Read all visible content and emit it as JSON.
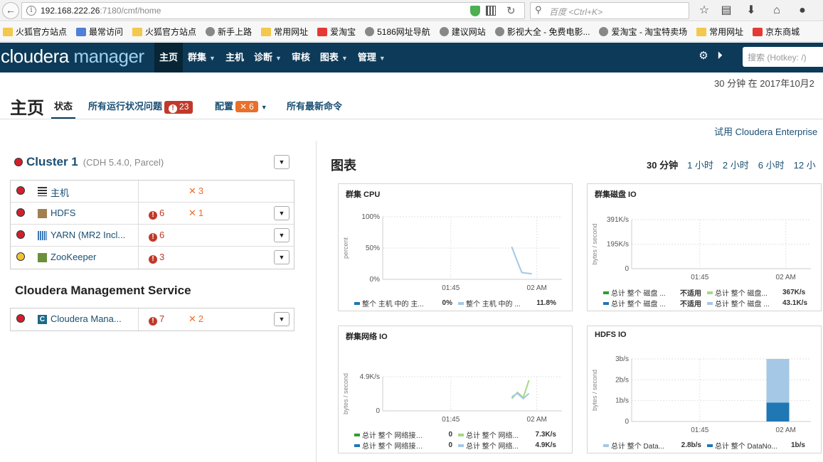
{
  "browser": {
    "url_host": "192.168.222.26",
    "url_rest": ":7180/cmf/home",
    "search_placeholder": "百度 <Ctrl+K>",
    "bookmarks": [
      {
        "label": "火狐官方站点",
        "icon": "folder"
      },
      {
        "label": "最常访问",
        "icon": "blue"
      },
      {
        "label": "火狐官方站点",
        "icon": "folder"
      },
      {
        "label": "新手上路",
        "icon": "globe"
      },
      {
        "label": "常用网址",
        "icon": "folder"
      },
      {
        "label": "爱淘宝",
        "icon": "red"
      },
      {
        "label": "5186网址导航",
        "icon": "globe"
      },
      {
        "label": "建议网站",
        "icon": "globe"
      },
      {
        "label": "影视大全 - 免费电影...",
        "icon": "globe"
      },
      {
        "label": "爱淘宝 - 淘宝特卖场",
        "icon": "globe"
      },
      {
        "label": "常用网址",
        "icon": "folder"
      },
      {
        "label": "京东商城",
        "icon": "red"
      }
    ]
  },
  "header": {
    "logo_a": "cloudera",
    "logo_b": "manager",
    "menu": [
      {
        "label": "主页",
        "caret": false,
        "active": true
      },
      {
        "label": "群集",
        "caret": true,
        "active": false
      },
      {
        "label": "主机",
        "caret": false,
        "active": false
      },
      {
        "label": "诊断",
        "caret": true,
        "active": false
      },
      {
        "label": "审核",
        "caret": false,
        "active": false
      },
      {
        "label": "图表",
        "caret": true,
        "active": false
      },
      {
        "label": "管理",
        "caret": true,
        "active": false
      }
    ],
    "search_placeholder": "搜索 (Hotkey: /)"
  },
  "page": {
    "timestamp": "30 分钟 在 2017年10月2",
    "title": "主页",
    "tabs": {
      "status": "状态",
      "health": "所有运行状况问题",
      "health_count": "23",
      "config": "配置",
      "config_count": "6",
      "commands": "所有最新命令"
    },
    "try_link": "试用 Cloudera Enterprise"
  },
  "cluster": {
    "name": "Cluster 1",
    "version": "(CDH 5.4.0, Parcel)",
    "services": [
      {
        "label": "主机",
        "status": "red",
        "errors": "",
        "configs": "3",
        "dropdown": false,
        "icon": "hosts"
      },
      {
        "label": "HDFS",
        "status": "red",
        "errors": "6",
        "configs": "1",
        "dropdown": true,
        "icon": "hdfs"
      },
      {
        "label": "YARN (MR2 Incl...",
        "status": "red",
        "errors": "6",
        "configs": "",
        "dropdown": true,
        "icon": "yarn"
      },
      {
        "label": "ZooKeeper",
        "status": "yellow",
        "errors": "3",
        "configs": "",
        "dropdown": true,
        "icon": "zk"
      }
    ]
  },
  "cms": {
    "title": "Cloudera Management Service",
    "services": [
      {
        "label": "Cloudera Mana...",
        "status": "red",
        "errors": "7",
        "configs": "2",
        "dropdown": true,
        "icon": "cm"
      }
    ]
  },
  "charts_section": {
    "title": "图表",
    "ranges": [
      "30 分钟",
      "1 小时",
      "2 小时",
      "6 小时",
      "12 小"
    ],
    "current_range": "30 分钟"
  },
  "chart_data": [
    {
      "type": "line",
      "title": "群集 CPU",
      "ylabel": "percent",
      "y_ticks": [
        "100%",
        "50%",
        "0%"
      ],
      "ylim": [
        0,
        100
      ],
      "x_ticks": [
        "01:45",
        "02 AM"
      ],
      "series": [
        {
          "color": "#a4c8e5",
          "points": [
            [
              0.9,
              52
            ],
            [
              0.94,
              28
            ],
            [
              0.97,
              11
            ],
            [
              1.0,
              10
            ],
            [
              1.04,
              9
            ]
          ]
        }
      ],
      "legend": [
        {
          "name": "整个 主机 中的 主...",
          "value": "0%",
          "color": "#1f77b4"
        },
        {
          "name": "整个 主机 中的 ...",
          "value": "11.8%",
          "color": "#a4c8e5"
        }
      ]
    },
    {
      "type": "line",
      "title": "群集磁盘 IO",
      "ylabel": "bytes / second",
      "y_ticks": [
        "391K/s",
        "195K/s",
        "0"
      ],
      "ylim": [
        0,
        391
      ],
      "x_ticks": [
        "01:45",
        "02 AM"
      ],
      "series": [],
      "legend": [
        {
          "name": "总计 整个 磁盘 ...",
          "value": "不适用",
          "color": "#2ca02c"
        },
        {
          "name": "总计 整个 磁盘...",
          "value": "367K/s",
          "color": "#a6d785"
        },
        {
          "name": "总计 整个 磁盘 ...",
          "value": "不适用",
          "color": "#1f77b4"
        },
        {
          "name": "总计 整个 磁盘 ...",
          "value": "43.1K/s",
          "color": "#a4c8e5"
        }
      ]
    },
    {
      "type": "line",
      "title": "群集网络 IO",
      "ylabel": "bytes / second",
      "y_ticks": [
        "4.9K/s",
        "0"
      ],
      "ylim": [
        0,
        9.8
      ],
      "x_ticks": [
        "01:45",
        "02 AM"
      ],
      "series": [
        {
          "color": "#a6d785",
          "points": [
            [
              0.9,
              3.5
            ],
            [
              0.94,
              5.3
            ],
            [
              0.98,
              3.8
            ],
            [
              1.02,
              8.8
            ]
          ]
        },
        {
          "color": "#a4c8e5",
          "points": [
            [
              0.9,
              4.0
            ],
            [
              0.94,
              5.0
            ],
            [
              0.98,
              3.5
            ],
            [
              1.02,
              5.0
            ]
          ]
        }
      ],
      "legend": [
        {
          "name": "总计 整个 网络接口 ...",
          "value": "0",
          "color": "#2ca02c"
        },
        {
          "name": "总计 整个 网络...",
          "value": "7.3K/s",
          "color": "#a6d785"
        },
        {
          "name": "总计 整个 网络接口 ...",
          "value": "0",
          "color": "#1f77b4"
        },
        {
          "name": "总计 整个 网络...",
          "value": "4.9K/s",
          "color": "#a4c8e5"
        }
      ]
    },
    {
      "type": "bar",
      "title": "HDFS IO",
      "ylabel": "bytes / second",
      "y_ticks": [
        "3b/s",
        "2b/s",
        "1b/s",
        "0"
      ],
      "ylim": [
        0,
        3.3
      ],
      "x_ticks": [
        "01:45",
        "02 AM"
      ],
      "bars": [
        {
          "x": 0.95,
          "bottom": 0,
          "top": 1,
          "color": "#1f77b4"
        },
        {
          "x": 0.95,
          "bottom": 1,
          "top": 3.8,
          "color": "#a4c8e5"
        }
      ],
      "legend": [
        {
          "name": "总计 整个 Data...",
          "value": "2.8b/s",
          "color": "#a4c8e5"
        },
        {
          "name": "总计 整个 DataNo...",
          "value": "1b/s",
          "color": "#1f77b4"
        }
      ]
    }
  ]
}
